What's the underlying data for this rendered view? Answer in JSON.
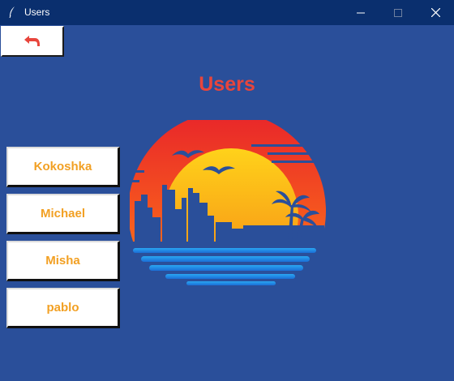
{
  "window": {
    "title": "Users"
  },
  "icons": {
    "app": "feather-icon",
    "minimize": "minimize-icon",
    "maximize": "maximize-icon",
    "close": "close-icon",
    "back": "back-arrow-icon",
    "logo": "sunset-city-logo"
  },
  "colors": {
    "background": "#2a4f9a",
    "titlebar": "#0a2f6e",
    "heading": "#e8453c",
    "button_text": "#f2a023",
    "back_arrow": "#e8453c"
  },
  "page": {
    "heading": "Users"
  },
  "users": [
    "Kokoshka",
    "Michael",
    "Misha",
    "pablo"
  ]
}
